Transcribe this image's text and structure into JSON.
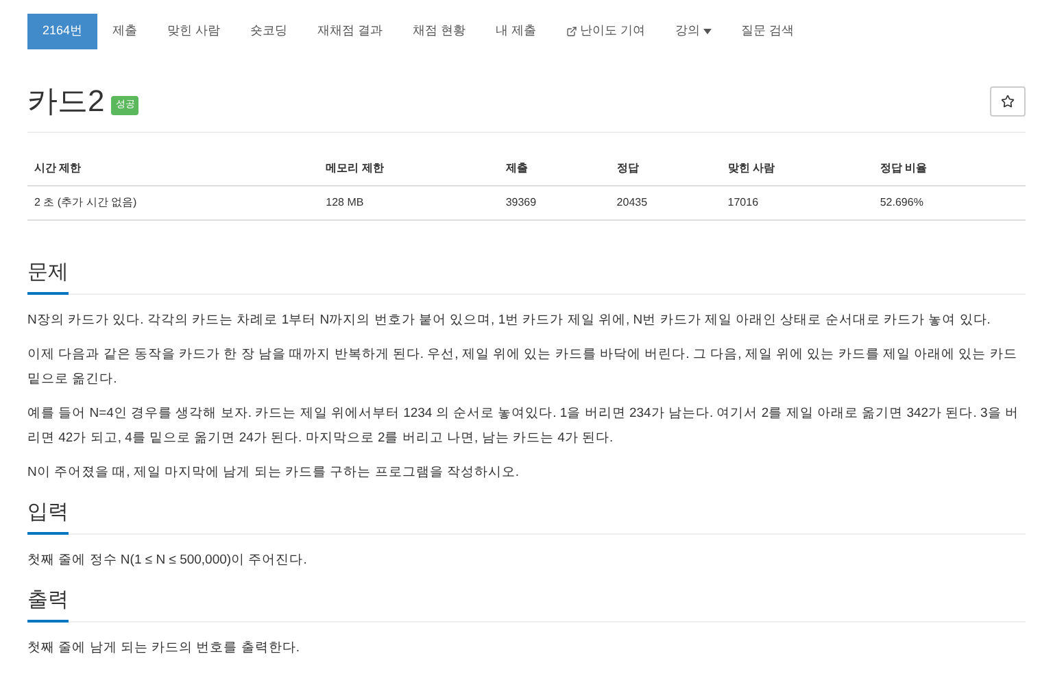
{
  "nav": [
    {
      "label": "2164번",
      "kind": "plain",
      "selected": true
    },
    {
      "label": "제출",
      "kind": "plain",
      "selected": false
    },
    {
      "label": "맞힌 사람",
      "kind": "plain",
      "selected": false
    },
    {
      "label": "숏코딩",
      "kind": "plain",
      "selected": false
    },
    {
      "label": "재채점 결과",
      "kind": "plain",
      "selected": false
    },
    {
      "label": "채점 현황",
      "kind": "plain",
      "selected": false
    },
    {
      "label": "내 제출",
      "kind": "plain",
      "selected": false
    },
    {
      "label": "난이도 기여",
      "kind": "external",
      "selected": false
    },
    {
      "label": "강의",
      "kind": "dropdown",
      "selected": false
    },
    {
      "label": "질문 검색",
      "kind": "plain",
      "selected": false
    }
  ],
  "problem": {
    "title": "카드2",
    "badge": "성공"
  },
  "info_table": {
    "columns": [
      "시간 제한",
      "메모리 제한",
      "제출",
      "정답",
      "맞힌 사람",
      "정답 비율"
    ],
    "rows": [
      [
        "2 초 (추가 시간 없음)",
        "128 MB",
        "39369",
        "20435",
        "17016",
        "52.696%"
      ]
    ]
  },
  "sections": [
    {
      "heading": "문제",
      "paragraphs": [
        "N장의 카드가 있다. 각각의 카드는 차례로 1부터 N까지의 번호가 붙어 있으며, 1번 카드가 제일 위에, N번 카드가 제일 아래인 상태로 순서대로 카드가 놓여 있다.",
        "이제 다음과 같은 동작을 카드가 한 장 남을 때까지 반복하게 된다. 우선, 제일 위에 있는 카드를 바닥에 버린다. 그 다음, 제일 위에 있는 카드를 제일 아래에 있는 카드 밑으로 옮긴다.",
        "예를 들어 N=4인 경우를 생각해 보자. 카드는 제일 위에서부터 1234 의 순서로 놓여있다. 1을 버리면 234가 남는다. 여기서 2를 제일 아래로 옮기면 342가 된다. 3을 버리면 42가 되고, 4를 밑으로 옮기면 24가 된다. 마지막으로 2를 버리고 나면, 남는 카드는 4가 된다.",
        "N이 주어졌을 때, 제일 마지막에 남게 되는 카드를 구하는 프로그램을 작성하시오."
      ]
    },
    {
      "heading": "입력",
      "paragraphs": [
        "첫째 줄에 정수 N(1 ≤ N ≤ 500,000)이 주어진다."
      ]
    },
    {
      "heading": "출력",
      "paragraphs": [
        "첫째 줄에 남게 되는 카드의 번호를 출력한다."
      ]
    }
  ]
}
